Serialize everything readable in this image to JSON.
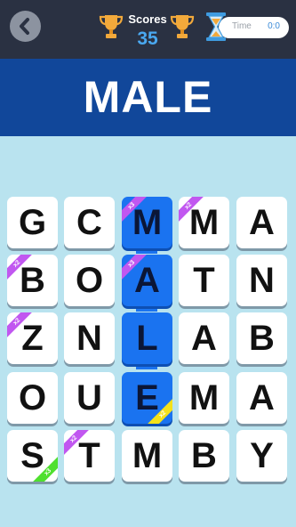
{
  "header": {
    "scores_label": "Scores",
    "score": "35",
    "time_label": "Time",
    "time_value": "0:0"
  },
  "target_word": "MALE",
  "colors": {
    "topbar": "#2a3142",
    "banner": "#11479a",
    "background": "#b9e3ef",
    "selected_tile": "#1a73f0",
    "score_text": "#4aa8f0"
  },
  "board": {
    "rows": [
      [
        {
          "letter": "G"
        },
        {
          "letter": "C"
        },
        {
          "letter": "M",
          "selected": true,
          "badge": "x3",
          "badge_color": "purple",
          "badge_corner": "tl"
        },
        {
          "letter": "M",
          "badge": "x2",
          "badge_color": "purple",
          "badge_corner": "tl"
        },
        {
          "letter": "A"
        }
      ],
      [
        {
          "letter": "B",
          "badge": "x2",
          "badge_color": "purple",
          "badge_corner": "tl"
        },
        {
          "letter": "O"
        },
        {
          "letter": "A",
          "selected": true,
          "badge": "x3",
          "badge_color": "purple",
          "badge_corner": "tl"
        },
        {
          "letter": "T"
        },
        {
          "letter": "N"
        }
      ],
      [
        {
          "letter": "Z",
          "badge": "x2",
          "badge_color": "purple",
          "badge_corner": "tl"
        },
        {
          "letter": "N"
        },
        {
          "letter": "L",
          "selected": true
        },
        {
          "letter": "A"
        },
        {
          "letter": "B"
        }
      ],
      [
        {
          "letter": "O"
        },
        {
          "letter": "U"
        },
        {
          "letter": "E",
          "selected": true,
          "badge": "x2",
          "badge_color": "yellow",
          "badge_corner": "br"
        },
        {
          "letter": "M"
        },
        {
          "letter": "A"
        }
      ],
      [
        {
          "letter": "S",
          "badge": "x3",
          "badge_color": "green",
          "badge_corner": "br"
        },
        {
          "letter": "T",
          "badge": "x2",
          "badge_color": "purple",
          "badge_corner": "tl"
        },
        {
          "letter": "M"
        },
        {
          "letter": "B"
        },
        {
          "letter": "Y"
        }
      ]
    ]
  }
}
